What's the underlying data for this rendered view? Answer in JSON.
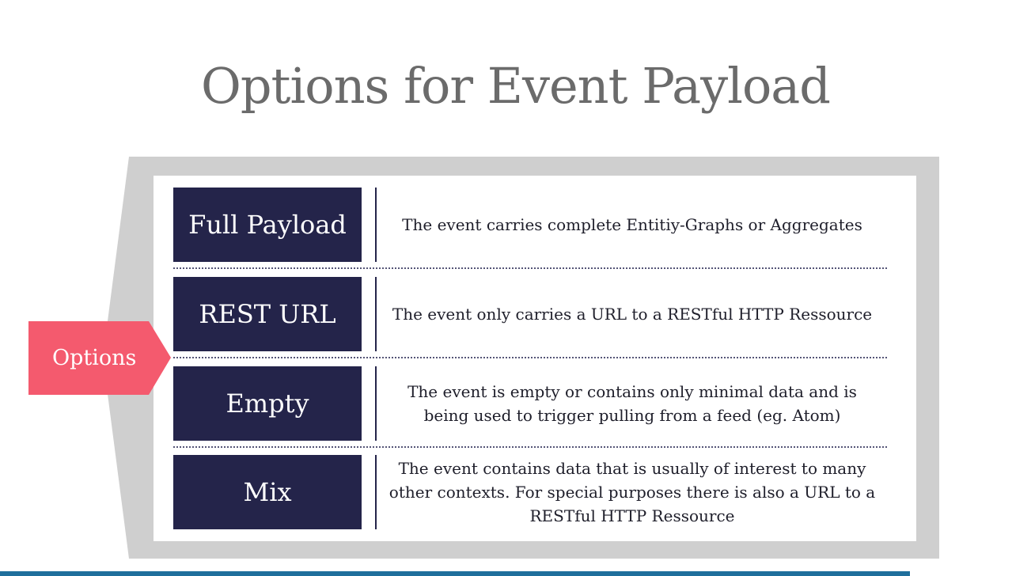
{
  "title": "Options for Event Payload",
  "options_label": "Options",
  "rows": [
    {
      "label": "Full Payload",
      "description": "The event carries complete Entitiy-Graphs or Aggregates"
    },
    {
      "label": "REST URL",
      "description": "The event only carries a URL to a RESTful HTTP Ressource"
    },
    {
      "label": "Empty",
      "description": "The event is empty or contains only minimal data and is being used to trigger pulling from a feed (eg. Atom)"
    },
    {
      "label": "Mix",
      "description": "The event contains data that is usually of interest to many other contexts. For special purposes there is also a URL to a RESTful HTTP Ressource"
    }
  ],
  "colors": {
    "title": "#6b6b6b",
    "label_box": "#24244a",
    "options_tag": "#f45a6e",
    "backdrop": "#cfcfcf"
  }
}
